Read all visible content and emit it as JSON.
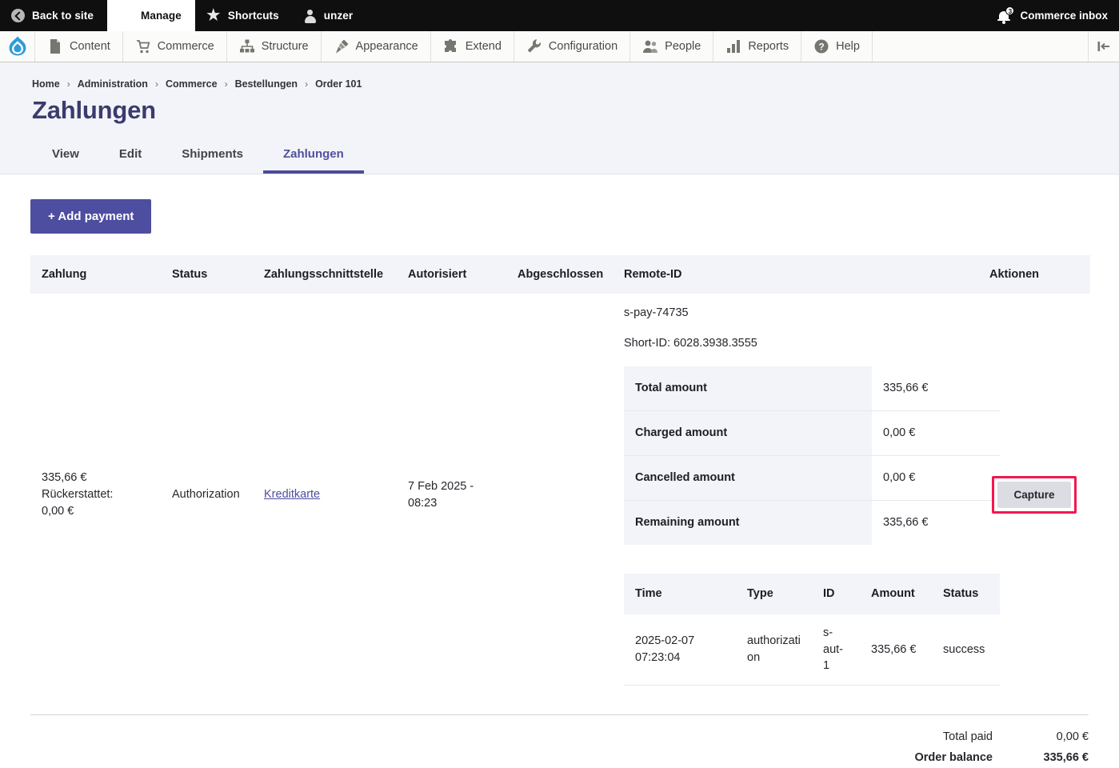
{
  "adminbar": {
    "back_to_site": "Back to site",
    "manage": "Manage",
    "shortcuts": "Shortcuts",
    "user": "unzer",
    "inbox": "Commerce inbox",
    "inbox_badge": "3"
  },
  "toolbar": {
    "items": [
      {
        "label": "Content",
        "icon": "document-icon"
      },
      {
        "label": "Commerce",
        "icon": "shopping-cart-icon"
      },
      {
        "label": "Structure",
        "icon": "sitemap-icon"
      },
      {
        "label": "Appearance",
        "icon": "paintbrush-icon"
      },
      {
        "label": "Extend",
        "icon": "puzzle-piece-icon"
      },
      {
        "label": "Configuration",
        "icon": "wrench-icon"
      },
      {
        "label": "People",
        "icon": "people-icon"
      },
      {
        "label": "Reports",
        "icon": "bar-chart-icon"
      },
      {
        "label": "Help",
        "icon": "question-circle-icon"
      }
    ]
  },
  "breadcrumb": [
    "Home",
    "Administration",
    "Commerce",
    "Bestellungen",
    "Order 101"
  ],
  "page": {
    "title": "Zahlungen"
  },
  "tabs": [
    {
      "label": "View",
      "active": false
    },
    {
      "label": "Edit",
      "active": false
    },
    {
      "label": "Shipments",
      "active": false
    },
    {
      "label": "Zahlungen",
      "active": true
    }
  ],
  "actions": {
    "add_payment": "+ Add payment",
    "capture": "Capture"
  },
  "table": {
    "headers": [
      "Zahlung",
      "Status",
      "Zahlungsschnittstelle",
      "Autorisiert",
      "Abgeschlossen",
      "Remote-ID",
      "Aktionen"
    ],
    "row": {
      "zahlung_amount": "335,66 €",
      "zahlung_refunded_label": "Rückerstattet:",
      "zahlung_refunded_value": "0,00 €",
      "status": "Authorization",
      "gateway": "Kreditkarte",
      "authorized": "7 Feb 2025 - 08:23",
      "completed": "",
      "remote_id": "s-pay-74735",
      "short_id": "Short-ID: 6028.3938.3555"
    }
  },
  "amounts": [
    {
      "label": "Total amount",
      "value": "335,66 €"
    },
    {
      "label": "Charged amount",
      "value": "0,00 €"
    },
    {
      "label": "Cancelled amount",
      "value": "0,00 €"
    },
    {
      "label": "Remaining amount",
      "value": "335,66 €"
    }
  ],
  "transactions": {
    "headers": [
      "Time",
      "Type",
      "ID",
      "Amount",
      "Status"
    ],
    "rows": [
      {
        "time": "2025-02-07 07:23:04",
        "type": "authorization",
        "id": "s-aut-1",
        "amount": "335,66 €",
        "status": "success"
      }
    ]
  },
  "totals": {
    "total_paid_label": "Total paid",
    "total_paid_value": "0,00 €",
    "order_balance_label": "Order balance",
    "order_balance_value": "335,66 €"
  },
  "colors": {
    "brand_purple": "#4d4ea0",
    "title_purple": "#3b3b6d",
    "focus_ring_pink": "#f5164f",
    "page_bg": "#f3f4f9"
  }
}
